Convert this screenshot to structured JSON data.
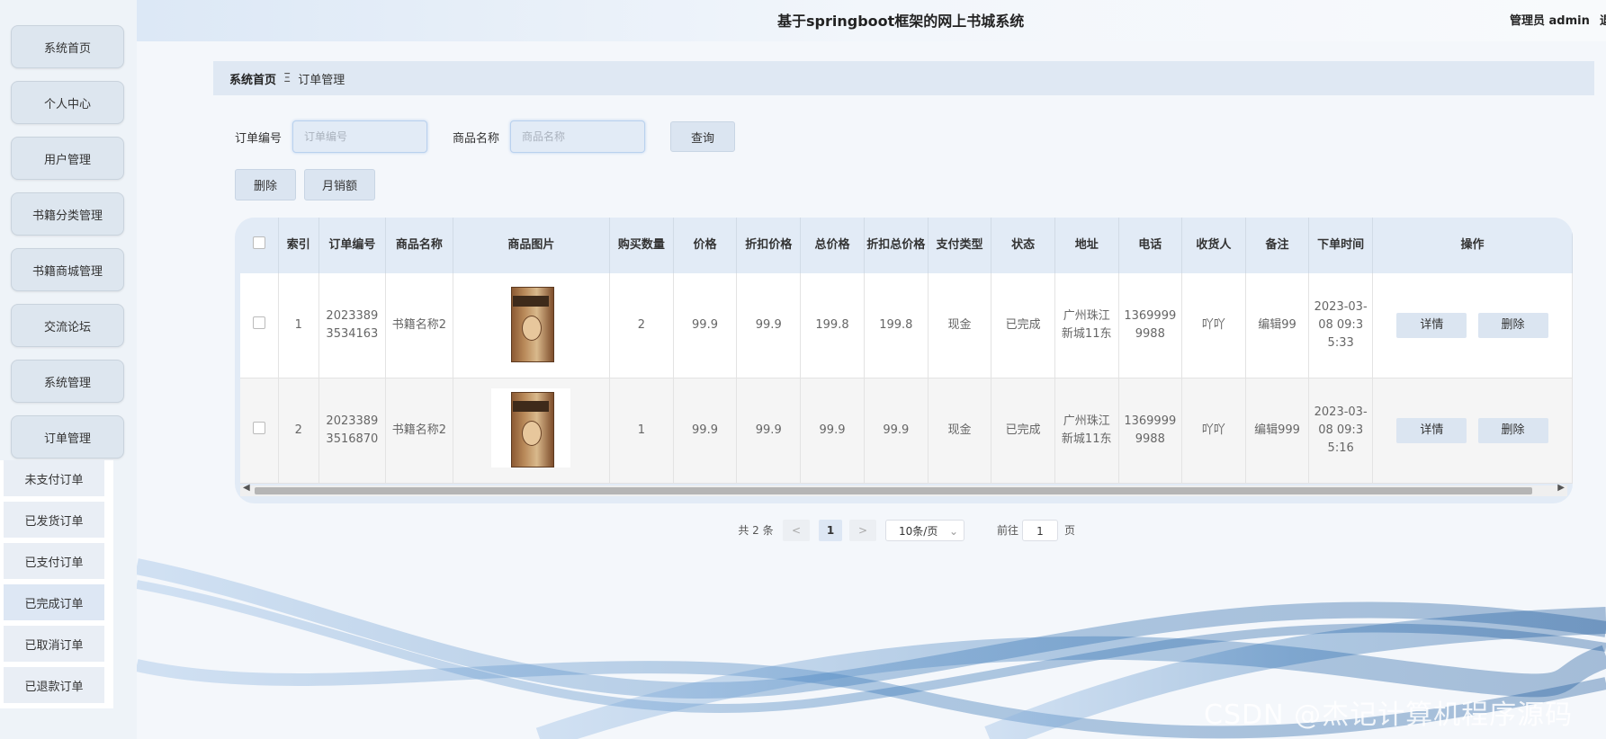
{
  "header": {
    "title": "基于springboot框架的网上书城系统",
    "admin": "管理员 admin",
    "extra": "退"
  },
  "sidebar": {
    "items": [
      {
        "label": "系统首页"
      },
      {
        "label": "个人中心"
      },
      {
        "label": "用户管理"
      },
      {
        "label": "书籍分类管理"
      },
      {
        "label": "书籍商城管理"
      },
      {
        "label": "交流论坛"
      },
      {
        "label": "系统管理"
      },
      {
        "label": "订单管理"
      }
    ],
    "submenu": [
      {
        "label": "未支付订单"
      },
      {
        "label": "已发货订单"
      },
      {
        "label": "已支付订单"
      },
      {
        "label": "已完成订单"
      },
      {
        "label": "已取消订单"
      },
      {
        "label": "已退款订单"
      }
    ]
  },
  "breadcrumb": {
    "home": "系统首页",
    "separator": "Ξ",
    "current": "订单管理"
  },
  "search": {
    "order_label": "订单编号",
    "order_placeholder": "订单编号",
    "product_label": "商品名称",
    "product_placeholder": "商品名称",
    "query_button": "查询"
  },
  "actions": {
    "delete": "删除",
    "monthly_sales": "月销额"
  },
  "table": {
    "headers": [
      "索引",
      "订单编号",
      "商品名称",
      "商品图片",
      "购买数量",
      "价格",
      "折扣价格",
      "总价格",
      "折扣总价格",
      "支付类型",
      "状态",
      "地址",
      "电话",
      "收货人",
      "备注",
      "下单时间",
      "操作"
    ],
    "rows": [
      {
        "index": "1",
        "order_no": "20233893534163",
        "product": "书籍名称2",
        "qty": "2",
        "price": "99.9",
        "discount_price": "99.9",
        "total": "199.8",
        "discount_total": "199.8",
        "pay_type": "现金",
        "status": "已完成",
        "address": "广州珠江新城11东",
        "phone": "13699999988",
        "receiver": "吖吖",
        "note": "编辑99",
        "time": "2023-03-08 09:35:33",
        "detail_btn": "详情",
        "delete_btn": "删除"
      },
      {
        "index": "2",
        "order_no": "20233893516870",
        "product": "书籍名称2",
        "qty": "1",
        "price": "99.9",
        "discount_price": "99.9",
        "total": "99.9",
        "discount_total": "99.9",
        "pay_type": "现金",
        "status": "已完成",
        "address": "广州珠江新城11东",
        "phone": "13699999988",
        "receiver": "吖吖",
        "note": "编辑999",
        "time": "2023-03-08 09:35:16",
        "detail_btn": "详情",
        "delete_btn": "删除"
      }
    ]
  },
  "pagination": {
    "total": "共 2 条",
    "prev": "<",
    "page": "1",
    "next": ">",
    "page_size": "10条/页",
    "goto_prefix": "前往",
    "goto_value": "1",
    "goto_suffix": "页"
  },
  "watermark": "CSDN @杰记计算机程序源码",
  "colors": {
    "accent": "#dbe5f1",
    "table_header": "#e2ebf6"
  }
}
